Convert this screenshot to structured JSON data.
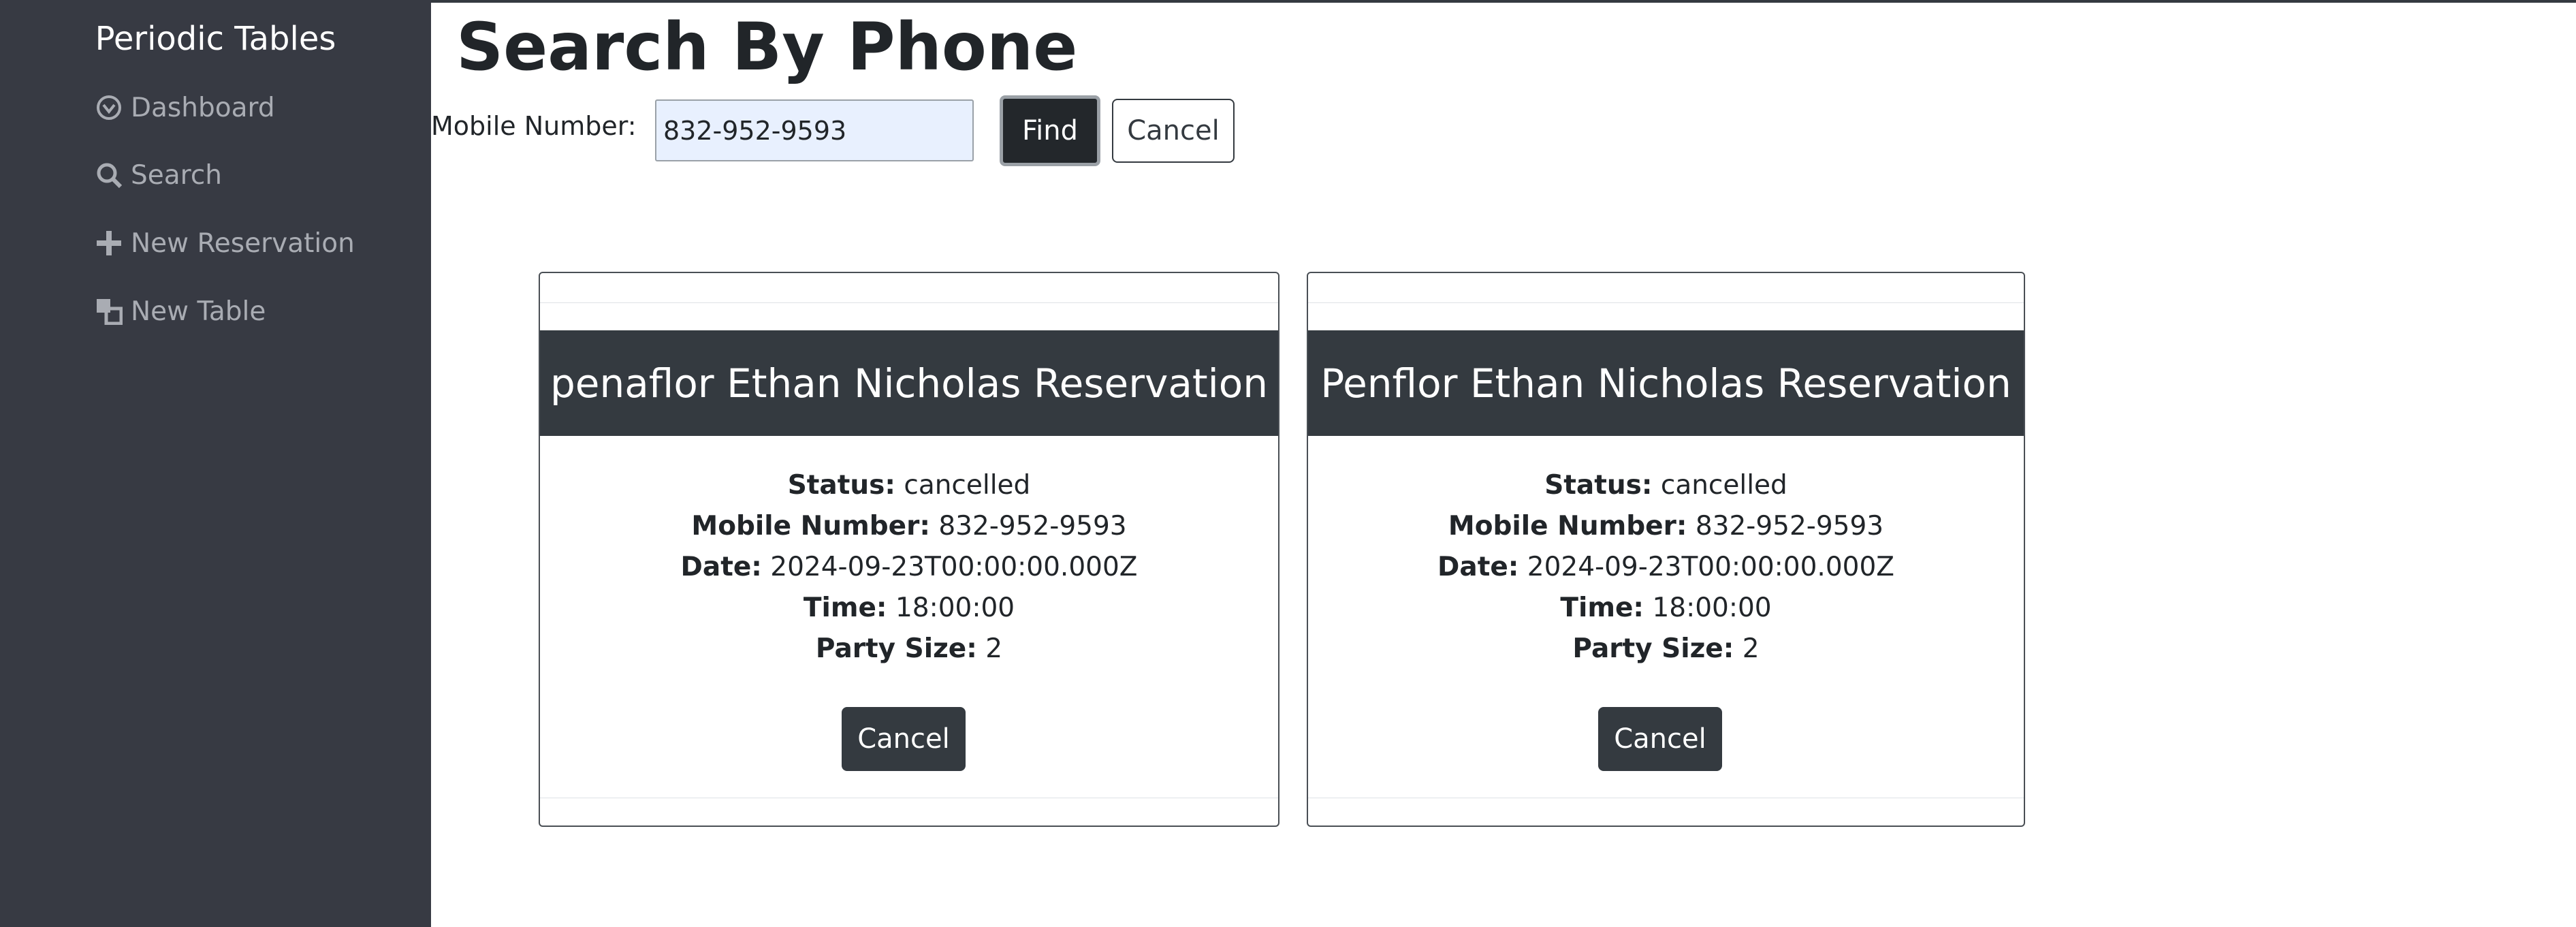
{
  "sidebar": {
    "brand": "Periodic Tables",
    "items": [
      {
        "label": "Dashboard",
        "icon": "dashboard-icon"
      },
      {
        "label": "Search",
        "icon": "search-icon"
      },
      {
        "label": "New Reservation",
        "icon": "plus-icon"
      },
      {
        "label": "New Table",
        "icon": "new-table-icon"
      }
    ]
  },
  "page": {
    "title": "Search By Phone"
  },
  "search": {
    "label": "Mobile Number:",
    "value": "832-952-9593",
    "find_label": "Find",
    "cancel_label": "Cancel"
  },
  "reservations": [
    {
      "title": "penaflor Ethan Nicholas Reservation",
      "status_label": "Status:",
      "status": "cancelled",
      "mobile_label": "Mobile Number:",
      "mobile": "832-952-9593",
      "date_label": "Date:",
      "date": "2024-09-23T00:00:00.000Z",
      "time_label": "Time:",
      "time": "18:00:00",
      "party_label": "Party Size:",
      "party_size": "2",
      "cancel_label": "Cancel"
    },
    {
      "title": "Penflor Ethan Nicholas Reservation",
      "status_label": "Status:",
      "status": "cancelled",
      "mobile_label": "Mobile Number:",
      "mobile": "832-952-9593",
      "date_label": "Date:",
      "date": "2024-09-23T00:00:00.000Z",
      "time_label": "Time:",
      "time": "18:00:00",
      "party_label": "Party Size:",
      "party_size": "2",
      "cancel_label": "Cancel"
    }
  ],
  "colors": {
    "sidebar_bg": "#373a43",
    "dark": "#343a40",
    "input_bg": "#e8f0fe"
  }
}
